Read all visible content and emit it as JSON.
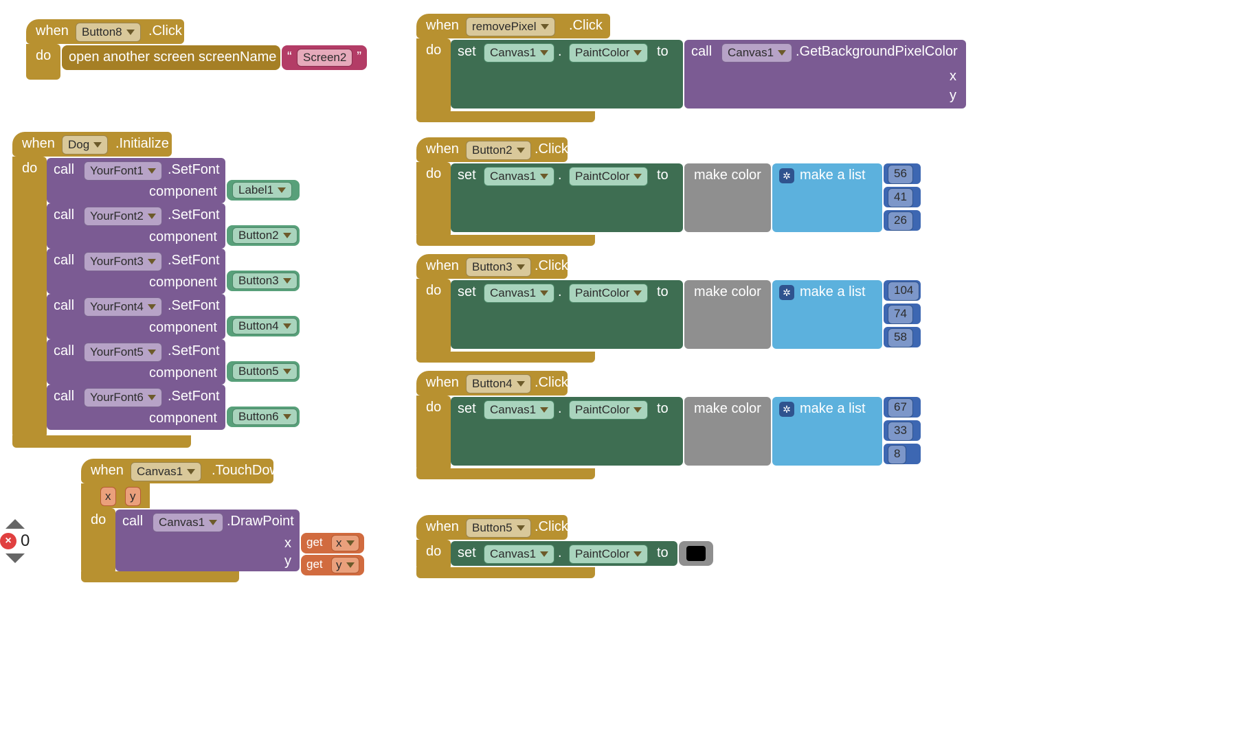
{
  "common": {
    "when": "when",
    "do": "do",
    "call": "call",
    "set": "set",
    "to": "to",
    "dot": ".",
    "click": ".Click",
    "component": "component",
    "get": "get",
    "make_color": "make color",
    "make_list": "make a list",
    "x": "x",
    "y": "y"
  },
  "button8": {
    "target": "Button8",
    "action": "open another screen  screenName",
    "quote_l": "“",
    "quote_r": "”",
    "screen": "Screen2"
  },
  "dog": {
    "target": "Dog",
    "event": ".Initialize",
    "calls": [
      {
        "font": "YourFont1",
        "method": ".SetFont",
        "comp": "Label1"
      },
      {
        "font": "YourFont2",
        "method": ".SetFont",
        "comp": "Button2"
      },
      {
        "font": "YourFont3",
        "method": ".SetFont",
        "comp": "Button3"
      },
      {
        "font": "YourFont4",
        "method": ".SetFont",
        "comp": "Button4"
      },
      {
        "font": "YourFont5",
        "method": ".SetFont",
        "comp": "Button5"
      },
      {
        "font": "YourFont6",
        "method": ".SetFont",
        "comp": "Button6"
      }
    ]
  },
  "touchdown": {
    "target": "Canvas1",
    "event": ".TouchDown",
    "call_target": "Canvas1",
    "method": ".DrawPoint",
    "px": "x",
    "py": "y"
  },
  "removePixel": {
    "target": "removePixel",
    "set_target": "Canvas1",
    "prop": "PaintColor",
    "call_target": "Canvas1",
    "call_method": ".GetBackgroundPixelColor"
  },
  "btn2": {
    "target": "Button2",
    "set_target": "Canvas1",
    "prop": "PaintColor",
    "r": "56",
    "g": "41",
    "b": "26"
  },
  "btn3": {
    "target": "Button3",
    "set_target": "Canvas1",
    "prop": "PaintColor",
    "r": "104",
    "g": "74",
    "b": "58"
  },
  "btn4": {
    "target": "Button4",
    "set_target": "Canvas1",
    "prop": "PaintColor",
    "r": "67",
    "g": "33",
    "b": "8"
  },
  "btn5": {
    "target": "Button5",
    "set_target": "Canvas1",
    "prop": "PaintColor"
  },
  "zoom": {
    "value": "0"
  }
}
